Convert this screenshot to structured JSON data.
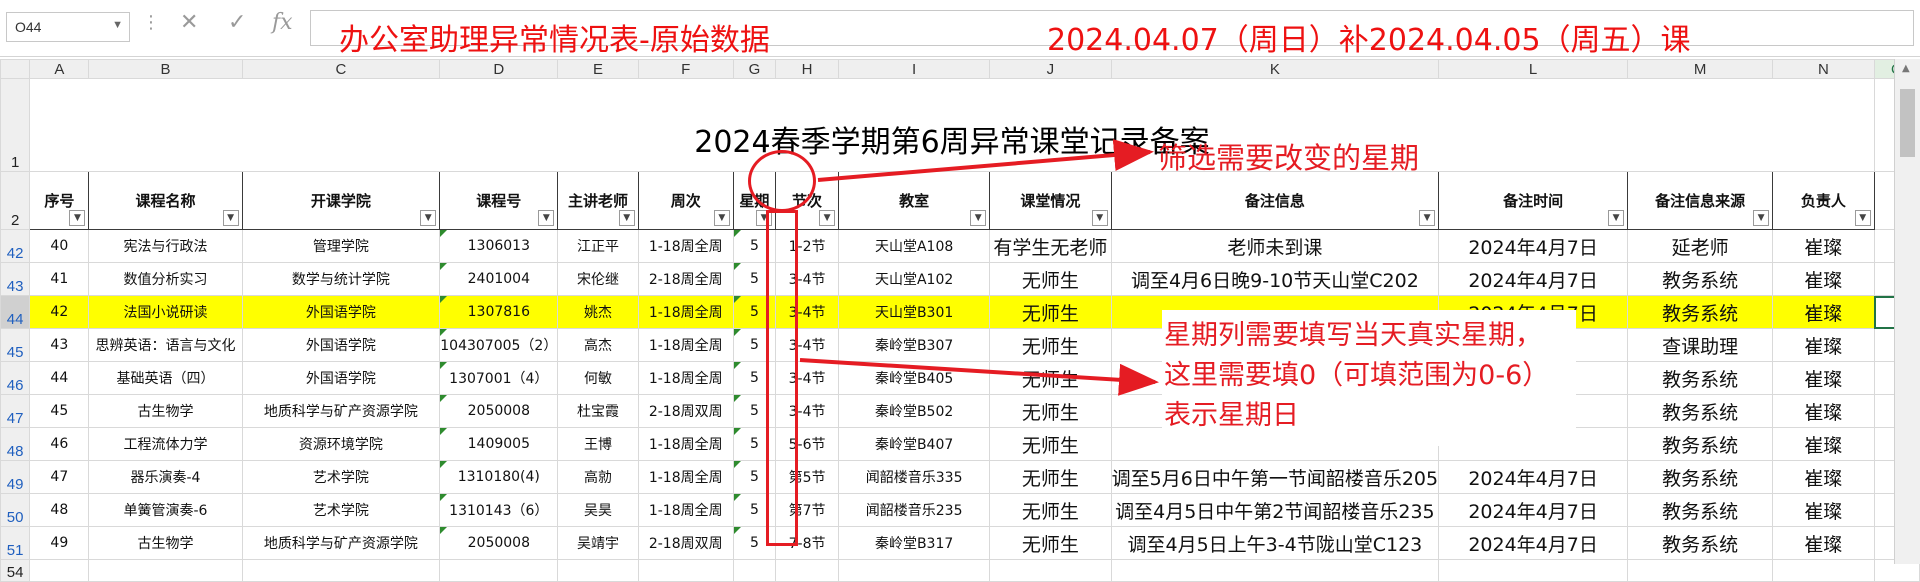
{
  "namebox": {
    "value": "O44"
  },
  "formula": {
    "icons": [
      "close-icon",
      "check-icon",
      "fx-icon"
    ],
    "text_title": "办公室助理异常情况表-原始数据",
    "text_date": "2024.04.07（周日）补2024.04.05（周五）课"
  },
  "columns": [
    "A",
    "B",
    "C",
    "D",
    "E",
    "F",
    "G",
    "H",
    "I",
    "J",
    "K",
    "L",
    "M",
    "N",
    "O"
  ],
  "sheet_title": "2024春季学期第6周异常课堂记录备案",
  "headers": [
    "序号",
    "课程名称",
    "开课学院",
    "课程号",
    "主讲老师",
    "周次",
    "星期",
    "节次",
    "教室",
    "课堂情况",
    "备注信息",
    "备注时间",
    "备注信息来源",
    "负责人"
  ],
  "row_numbers": [
    "1",
    "2",
    "42",
    "43",
    "44",
    "45",
    "46",
    "47",
    "48",
    "49",
    "50",
    "51",
    "54"
  ],
  "rows": [
    [
      "40",
      "宪法与行政法",
      "管理学院",
      "1306013",
      "江正平",
      "1-18周全周",
      "5",
      "1-2节",
      "天山堂A108",
      "有学生无老师",
      "老师未到课",
      "2024年4月7日",
      "延老师",
      "崔璨"
    ],
    [
      "41",
      "数值分析实习",
      "数学与统计学院",
      "2401004",
      "宋伦继",
      "2-18周全周",
      "5",
      "3-4节",
      "天山堂A102",
      "无师生",
      "调至4月6日晚9-10节天山堂C202",
      "2024年4月7日",
      "教务系统",
      "崔璨"
    ],
    [
      "42",
      "法国小说研读",
      "外国语学院",
      "1307816",
      "姚杰",
      "1-18周全周",
      "5",
      "3-4节",
      "天山堂B301",
      "无师生",
      "",
      "2024年4月7日",
      "教务系统",
      "崔璨"
    ],
    [
      "43",
      "思辨英语：语言与文化",
      "外国语学院",
      "104307005（2）",
      "高杰",
      "1-18周全周",
      "5",
      "3-4节",
      "秦岭堂B307",
      "无师生",
      "",
      "",
      "查课助理",
      "崔璨"
    ],
    [
      "44",
      "基础英语（四）",
      "外国语学院",
      "1307001（4）",
      "何敏",
      "1-18周全周",
      "5",
      "3-4节",
      "秦岭堂B405",
      "无师生",
      "",
      "",
      "教务系统",
      "崔璨"
    ],
    [
      "45",
      "古生物学",
      "地质科学与矿产资源学院",
      "2050008",
      "杜宝霞",
      "2-18周双周",
      "5",
      "3-4节",
      "秦岭堂B502",
      "无师生",
      "",
      "",
      "教务系统",
      "崔璨"
    ],
    [
      "46",
      "工程流体力学",
      "资源环境学院",
      "1409005",
      "王博",
      "1-18周全周",
      "5",
      "5-6节",
      "秦岭堂B407",
      "无师生",
      "",
      "",
      "教务系统",
      "崔璨"
    ],
    [
      "47",
      "器乐演奏-4",
      "艺术学院",
      "1310180(4)",
      "高勍",
      "1-18周全周",
      "5",
      "第5节",
      "闻韶楼音乐335",
      "无师生",
      "调至5月6日中午第一节闻韶楼音乐205",
      "2024年4月7日",
      "教务系统",
      "崔璨"
    ],
    [
      "48",
      "单簧管演奏-6",
      "艺术学院",
      "1310143（6）",
      "吴昊",
      "1-18周全周",
      "5",
      "第7节",
      "闻韶楼音乐235",
      "无师生",
      "调至4月5日中午第2节闻韶楼音乐235",
      "2024年4月7日",
      "教务系统",
      "崔璨"
    ],
    [
      "49",
      "古生物学",
      "地质科学与矿产资源学院",
      "2050008",
      "吴靖宇",
      "2-18周双周",
      "5",
      "7-8节",
      "秦岭堂B317",
      "无师生",
      "调至4月5日上午3-4节陇山堂C123",
      "2024年4月7日",
      "教务系统",
      "崔璨"
    ]
  ],
  "annotations": {
    "filter_note": "筛选需要改变的星期",
    "weekday_note": [
      "星期列需要填写当天真实星期，",
      "这里需要填0（可填范围为0-6）",
      "表示星期日"
    ]
  },
  "colors": {
    "annotation": "#e51c23",
    "highlight_row": "#ffff00",
    "selection": "#217346"
  }
}
